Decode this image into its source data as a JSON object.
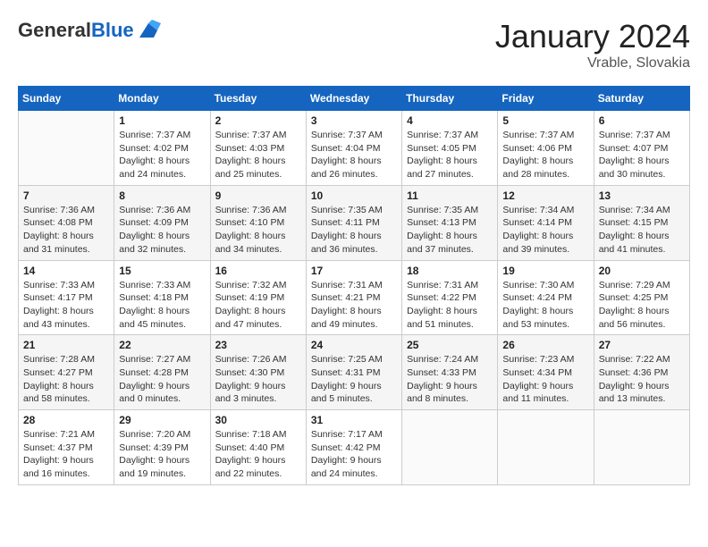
{
  "header": {
    "logo_general": "General",
    "logo_blue": "Blue",
    "month": "January 2024",
    "location": "Vrable, Slovakia"
  },
  "weekdays": [
    "Sunday",
    "Monday",
    "Tuesday",
    "Wednesday",
    "Thursday",
    "Friday",
    "Saturday"
  ],
  "weeks": [
    [
      {
        "day": "",
        "info": ""
      },
      {
        "day": "1",
        "info": "Sunrise: 7:37 AM\nSunset: 4:02 PM\nDaylight: 8 hours\nand 24 minutes."
      },
      {
        "day": "2",
        "info": "Sunrise: 7:37 AM\nSunset: 4:03 PM\nDaylight: 8 hours\nand 25 minutes."
      },
      {
        "day": "3",
        "info": "Sunrise: 7:37 AM\nSunset: 4:04 PM\nDaylight: 8 hours\nand 26 minutes."
      },
      {
        "day": "4",
        "info": "Sunrise: 7:37 AM\nSunset: 4:05 PM\nDaylight: 8 hours\nand 27 minutes."
      },
      {
        "day": "5",
        "info": "Sunrise: 7:37 AM\nSunset: 4:06 PM\nDaylight: 8 hours\nand 28 minutes."
      },
      {
        "day": "6",
        "info": "Sunrise: 7:37 AM\nSunset: 4:07 PM\nDaylight: 8 hours\nand 30 minutes."
      }
    ],
    [
      {
        "day": "7",
        "info": "Sunrise: 7:36 AM\nSunset: 4:08 PM\nDaylight: 8 hours\nand 31 minutes."
      },
      {
        "day": "8",
        "info": "Sunrise: 7:36 AM\nSunset: 4:09 PM\nDaylight: 8 hours\nand 32 minutes."
      },
      {
        "day": "9",
        "info": "Sunrise: 7:36 AM\nSunset: 4:10 PM\nDaylight: 8 hours\nand 34 minutes."
      },
      {
        "day": "10",
        "info": "Sunrise: 7:35 AM\nSunset: 4:11 PM\nDaylight: 8 hours\nand 36 minutes."
      },
      {
        "day": "11",
        "info": "Sunrise: 7:35 AM\nSunset: 4:13 PM\nDaylight: 8 hours\nand 37 minutes."
      },
      {
        "day": "12",
        "info": "Sunrise: 7:34 AM\nSunset: 4:14 PM\nDaylight: 8 hours\nand 39 minutes."
      },
      {
        "day": "13",
        "info": "Sunrise: 7:34 AM\nSunset: 4:15 PM\nDaylight: 8 hours\nand 41 minutes."
      }
    ],
    [
      {
        "day": "14",
        "info": "Sunrise: 7:33 AM\nSunset: 4:17 PM\nDaylight: 8 hours\nand 43 minutes."
      },
      {
        "day": "15",
        "info": "Sunrise: 7:33 AM\nSunset: 4:18 PM\nDaylight: 8 hours\nand 45 minutes."
      },
      {
        "day": "16",
        "info": "Sunrise: 7:32 AM\nSunset: 4:19 PM\nDaylight: 8 hours\nand 47 minutes."
      },
      {
        "day": "17",
        "info": "Sunrise: 7:31 AM\nSunset: 4:21 PM\nDaylight: 8 hours\nand 49 minutes."
      },
      {
        "day": "18",
        "info": "Sunrise: 7:31 AM\nSunset: 4:22 PM\nDaylight: 8 hours\nand 51 minutes."
      },
      {
        "day": "19",
        "info": "Sunrise: 7:30 AM\nSunset: 4:24 PM\nDaylight: 8 hours\nand 53 minutes."
      },
      {
        "day": "20",
        "info": "Sunrise: 7:29 AM\nSunset: 4:25 PM\nDaylight: 8 hours\nand 56 minutes."
      }
    ],
    [
      {
        "day": "21",
        "info": "Sunrise: 7:28 AM\nSunset: 4:27 PM\nDaylight: 8 hours\nand 58 minutes."
      },
      {
        "day": "22",
        "info": "Sunrise: 7:27 AM\nSunset: 4:28 PM\nDaylight: 9 hours\nand 0 minutes."
      },
      {
        "day": "23",
        "info": "Sunrise: 7:26 AM\nSunset: 4:30 PM\nDaylight: 9 hours\nand 3 minutes."
      },
      {
        "day": "24",
        "info": "Sunrise: 7:25 AM\nSunset: 4:31 PM\nDaylight: 9 hours\nand 5 minutes."
      },
      {
        "day": "25",
        "info": "Sunrise: 7:24 AM\nSunset: 4:33 PM\nDaylight: 9 hours\nand 8 minutes."
      },
      {
        "day": "26",
        "info": "Sunrise: 7:23 AM\nSunset: 4:34 PM\nDaylight: 9 hours\nand 11 minutes."
      },
      {
        "day": "27",
        "info": "Sunrise: 7:22 AM\nSunset: 4:36 PM\nDaylight: 9 hours\nand 13 minutes."
      }
    ],
    [
      {
        "day": "28",
        "info": "Sunrise: 7:21 AM\nSunset: 4:37 PM\nDaylight: 9 hours\nand 16 minutes."
      },
      {
        "day": "29",
        "info": "Sunrise: 7:20 AM\nSunset: 4:39 PM\nDaylight: 9 hours\nand 19 minutes."
      },
      {
        "day": "30",
        "info": "Sunrise: 7:18 AM\nSunset: 4:40 PM\nDaylight: 9 hours\nand 22 minutes."
      },
      {
        "day": "31",
        "info": "Sunrise: 7:17 AM\nSunset: 4:42 PM\nDaylight: 9 hours\nand 24 minutes."
      },
      {
        "day": "",
        "info": ""
      },
      {
        "day": "",
        "info": ""
      },
      {
        "day": "",
        "info": ""
      }
    ]
  ]
}
